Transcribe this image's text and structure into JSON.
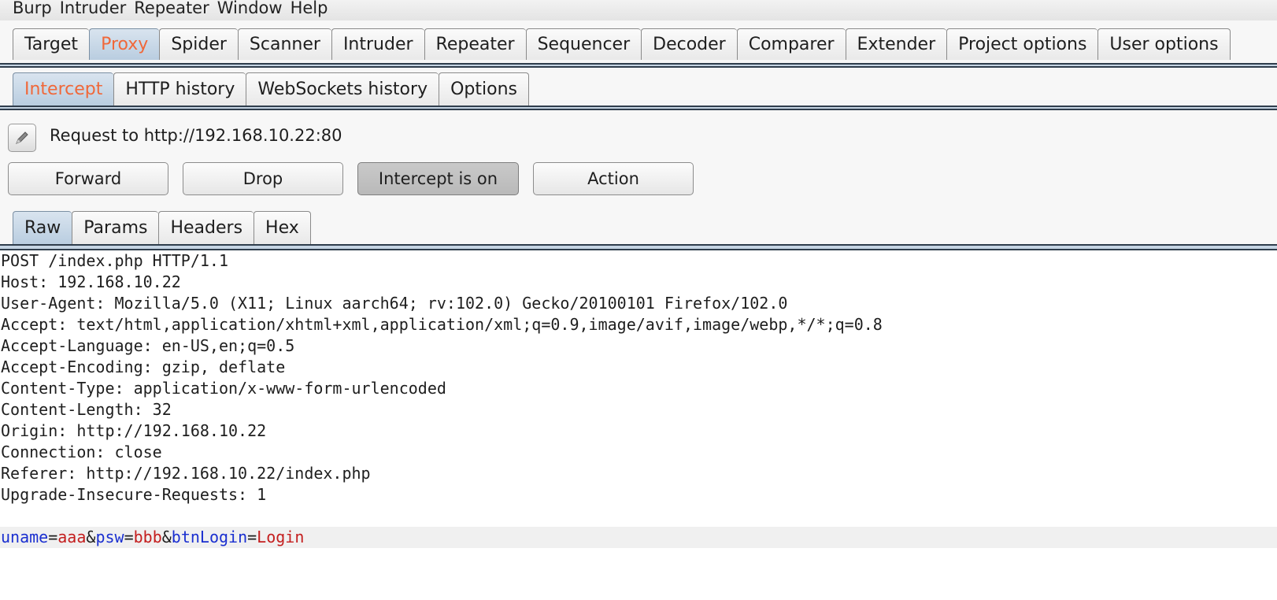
{
  "menubar": [
    "Burp",
    "Intruder",
    "Repeater",
    "Window",
    "Help"
  ],
  "main_tabs": [
    "Target",
    "Proxy",
    "Spider",
    "Scanner",
    "Intruder",
    "Repeater",
    "Sequencer",
    "Decoder",
    "Comparer",
    "Extender",
    "Project options",
    "User options"
  ],
  "active_main_tab": "Proxy",
  "proxy_tabs": [
    "Intercept",
    "HTTP history",
    "WebSockets history",
    "Options"
  ],
  "active_proxy_tab": "Intercept",
  "request_to": "Request to http://192.168.10.22:80",
  "buttons": {
    "forward": "Forward",
    "drop": "Drop",
    "intercept": "Intercept is on",
    "action": "Action"
  },
  "view_tabs": [
    "Raw",
    "Params",
    "Headers",
    "Hex"
  ],
  "active_view_tab": "Raw",
  "request_lines": [
    "POST /index.php HTTP/1.1",
    "Host: 192.168.10.22",
    "User-Agent: Mozilla/5.0 (X11; Linux aarch64; rv:102.0) Gecko/20100101 Firefox/102.0",
    "Accept: text/html,application/xhtml+xml,application/xml;q=0.9,image/avif,image/webp,*/*;q=0.8",
    "Accept-Language: en-US,en;q=0.5",
    "Accept-Encoding: gzip, deflate",
    "Content-Type: application/x-www-form-urlencoded",
    "Content-Length: 32",
    "Origin: http://192.168.10.22",
    "Connection: close",
    "Referer: http://192.168.10.22/index.php",
    "Upgrade-Insecure-Requests: 1"
  ],
  "body_params": [
    {
      "name": "uname",
      "value": "aaa"
    },
    {
      "name": "psw",
      "value": "bbb"
    },
    {
      "name": "btnLogin",
      "value": "Login"
    }
  ],
  "colors": {
    "active_tab_text": "#f0683a",
    "param_name": "#1a2fd0",
    "param_value": "#c41e1e"
  }
}
